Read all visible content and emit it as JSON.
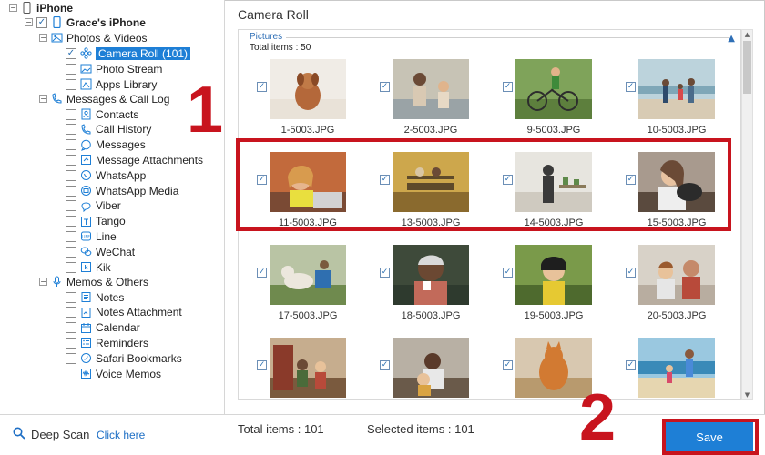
{
  "tree": {
    "root": "iPhone",
    "device": "Grace's iPhone",
    "photos_group": "Photos & Videos",
    "photos_items": [
      "Camera Roll (101)",
      "Photo Stream",
      "Apps Library"
    ],
    "messages_group": "Messages & Call Log",
    "messages_items": [
      "Contacts",
      "Call History",
      "Messages",
      "Message Attachments",
      "WhatsApp",
      "WhatsApp Media",
      "Viber",
      "Tango",
      "Line",
      "WeChat",
      "Kik"
    ],
    "memos_group": "Memos & Others",
    "memos_items": [
      "Notes",
      "Notes Attachment",
      "Calendar",
      "Reminders",
      "Safari Bookmarks",
      "Voice Memos"
    ]
  },
  "main": {
    "title": "Camera Roll",
    "group_label": "Pictures",
    "group_total": "Total items : 50",
    "photos": [
      {
        "name": "1-5003.JPG",
        "checked": true
      },
      {
        "name": "2-5003.JPG",
        "checked": true
      },
      {
        "name": "9-5003.JPG",
        "checked": true
      },
      {
        "name": "10-5003.JPG",
        "checked": true
      },
      {
        "name": "11-5003.JPG",
        "checked": true
      },
      {
        "name": "13-5003.JPG",
        "checked": true
      },
      {
        "name": "14-5003.JPG",
        "checked": true
      },
      {
        "name": "15-5003.JPG",
        "checked": true
      },
      {
        "name": "17-5003.JPG",
        "checked": true
      },
      {
        "name": "18-5003.JPG",
        "checked": true
      },
      {
        "name": "19-5003.JPG",
        "checked": true
      },
      {
        "name": "20-5003.JPG",
        "checked": true
      },
      {
        "name": "",
        "checked": true
      },
      {
        "name": "",
        "checked": true
      },
      {
        "name": "",
        "checked": true
      },
      {
        "name": "",
        "checked": true
      }
    ]
  },
  "footer": {
    "deep_scan": "Deep Scan",
    "click_here": "Click here",
    "total_items": "Total items : 101",
    "selected_items": "Selected items : 101",
    "save": "Save"
  },
  "annotations": {
    "step1": "1",
    "step2": "2",
    "color": "#c8141e"
  },
  "colors": {
    "accent": "#1e7fd6",
    "link": "#1e6fc5"
  }
}
